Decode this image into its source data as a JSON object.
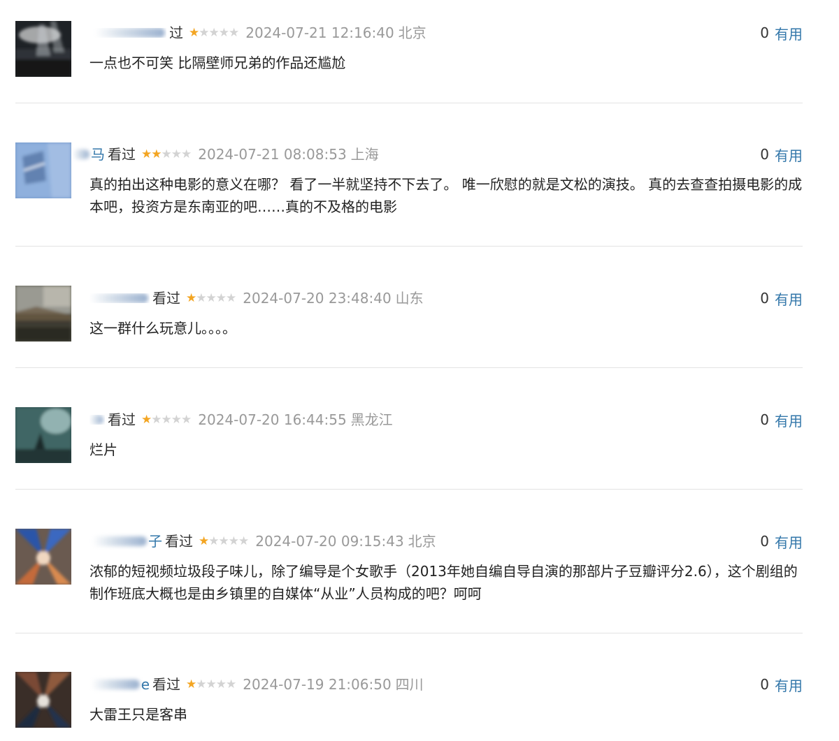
{
  "comments": [
    {
      "username_visible": "",
      "status": "过",
      "rating": 1,
      "time": "2024-07-21 12:16:40",
      "location": "北京",
      "votes": "0",
      "vote_label": "有用",
      "text": "一点也不可笑 比隔壁师兄弟的作品还尴尬"
    },
    {
      "username_visible": "马",
      "status": "看过",
      "rating": 2,
      "time": "2024-07-21 08:08:53",
      "location": "上海",
      "votes": "0",
      "vote_label": "有用",
      "text": "真的拍出这种电影的意义在哪？ 看了一半就坚持不下去了。 唯一欣慰的就是文松的演技。 真的去查查拍摄电影的成本吧，投资方是东南亚的吧……真的不及格的电影"
    },
    {
      "username_visible": "",
      "status": "看过",
      "rating": 1,
      "time": "2024-07-20 23:48:40",
      "location": "山东",
      "votes": "0",
      "vote_label": "有用",
      "text": "这一群什么玩意儿。。。。"
    },
    {
      "username_visible": "",
      "status": "看过",
      "rating": 1,
      "time": "2024-07-20 16:44:55",
      "location": "黑龙江",
      "votes": "0",
      "vote_label": "有用",
      "text": "烂片"
    },
    {
      "username_visible": "子",
      "status": "看过",
      "rating": 1,
      "time": "2024-07-20 09:15:43",
      "location": "北京",
      "votes": "0",
      "vote_label": "有用",
      "text": "浓郁的短视频垃圾段子味儿，除了编导是个女歌手（2013年她自编自导自演的那部片子豆瓣评分2.6），这个剧组的制作班底大概也是由乡镇里的自媒体“从业”人员构成的吧？呵呵"
    },
    {
      "username_visible": "e",
      "status": "看过",
      "rating": 1,
      "time": "2024-07-19 21:06:50",
      "location": "四川",
      "votes": "0",
      "vote_label": "有用",
      "text": "大雷王只是客串"
    }
  ],
  "colors": {
    "link": "#3377aa",
    "star": "#f3a522",
    "star_empty": "#d3d3d3",
    "meta_gray": "#999999",
    "text": "#222222"
  },
  "icons": {
    "star": "star-icon",
    "avatar": "avatar-image"
  }
}
